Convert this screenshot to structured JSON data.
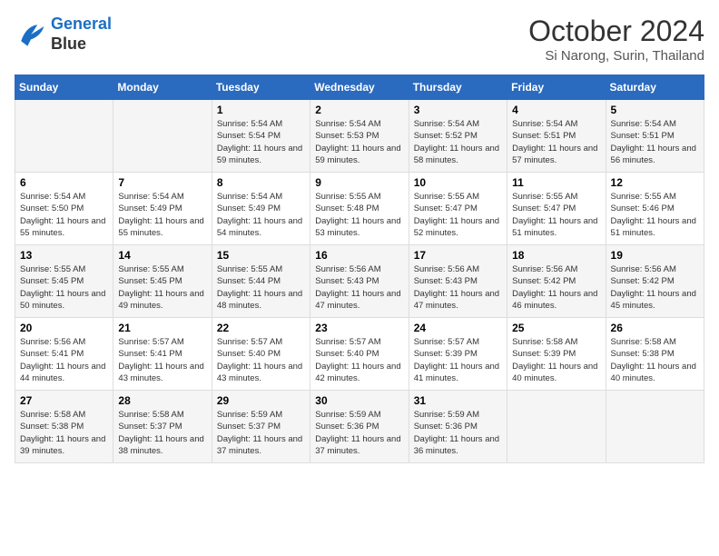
{
  "header": {
    "logo_line1": "General",
    "logo_line2": "Blue",
    "month": "October 2024",
    "location": "Si Narong, Surin, Thailand"
  },
  "weekdays": [
    "Sunday",
    "Monday",
    "Tuesday",
    "Wednesday",
    "Thursday",
    "Friday",
    "Saturday"
  ],
  "weeks": [
    [
      {
        "day": "",
        "info": ""
      },
      {
        "day": "",
        "info": ""
      },
      {
        "day": "1",
        "info": "Sunrise: 5:54 AM\nSunset: 5:54 PM\nDaylight: 11 hours and 59 minutes."
      },
      {
        "day": "2",
        "info": "Sunrise: 5:54 AM\nSunset: 5:53 PM\nDaylight: 11 hours and 59 minutes."
      },
      {
        "day": "3",
        "info": "Sunrise: 5:54 AM\nSunset: 5:52 PM\nDaylight: 11 hours and 58 minutes."
      },
      {
        "day": "4",
        "info": "Sunrise: 5:54 AM\nSunset: 5:51 PM\nDaylight: 11 hours and 57 minutes."
      },
      {
        "day": "5",
        "info": "Sunrise: 5:54 AM\nSunset: 5:51 PM\nDaylight: 11 hours and 56 minutes."
      }
    ],
    [
      {
        "day": "6",
        "info": "Sunrise: 5:54 AM\nSunset: 5:50 PM\nDaylight: 11 hours and 55 minutes."
      },
      {
        "day": "7",
        "info": "Sunrise: 5:54 AM\nSunset: 5:49 PM\nDaylight: 11 hours and 55 minutes."
      },
      {
        "day": "8",
        "info": "Sunrise: 5:54 AM\nSunset: 5:49 PM\nDaylight: 11 hours and 54 minutes."
      },
      {
        "day": "9",
        "info": "Sunrise: 5:55 AM\nSunset: 5:48 PM\nDaylight: 11 hours and 53 minutes."
      },
      {
        "day": "10",
        "info": "Sunrise: 5:55 AM\nSunset: 5:47 PM\nDaylight: 11 hours and 52 minutes."
      },
      {
        "day": "11",
        "info": "Sunrise: 5:55 AM\nSunset: 5:47 PM\nDaylight: 11 hours and 51 minutes."
      },
      {
        "day": "12",
        "info": "Sunrise: 5:55 AM\nSunset: 5:46 PM\nDaylight: 11 hours and 51 minutes."
      }
    ],
    [
      {
        "day": "13",
        "info": "Sunrise: 5:55 AM\nSunset: 5:45 PM\nDaylight: 11 hours and 50 minutes."
      },
      {
        "day": "14",
        "info": "Sunrise: 5:55 AM\nSunset: 5:45 PM\nDaylight: 11 hours and 49 minutes."
      },
      {
        "day": "15",
        "info": "Sunrise: 5:55 AM\nSunset: 5:44 PM\nDaylight: 11 hours and 48 minutes."
      },
      {
        "day": "16",
        "info": "Sunrise: 5:56 AM\nSunset: 5:43 PM\nDaylight: 11 hours and 47 minutes."
      },
      {
        "day": "17",
        "info": "Sunrise: 5:56 AM\nSunset: 5:43 PM\nDaylight: 11 hours and 47 minutes."
      },
      {
        "day": "18",
        "info": "Sunrise: 5:56 AM\nSunset: 5:42 PM\nDaylight: 11 hours and 46 minutes."
      },
      {
        "day": "19",
        "info": "Sunrise: 5:56 AM\nSunset: 5:42 PM\nDaylight: 11 hours and 45 minutes."
      }
    ],
    [
      {
        "day": "20",
        "info": "Sunrise: 5:56 AM\nSunset: 5:41 PM\nDaylight: 11 hours and 44 minutes."
      },
      {
        "day": "21",
        "info": "Sunrise: 5:57 AM\nSunset: 5:41 PM\nDaylight: 11 hours and 43 minutes."
      },
      {
        "day": "22",
        "info": "Sunrise: 5:57 AM\nSunset: 5:40 PM\nDaylight: 11 hours and 43 minutes."
      },
      {
        "day": "23",
        "info": "Sunrise: 5:57 AM\nSunset: 5:40 PM\nDaylight: 11 hours and 42 minutes."
      },
      {
        "day": "24",
        "info": "Sunrise: 5:57 AM\nSunset: 5:39 PM\nDaylight: 11 hours and 41 minutes."
      },
      {
        "day": "25",
        "info": "Sunrise: 5:58 AM\nSunset: 5:39 PM\nDaylight: 11 hours and 40 minutes."
      },
      {
        "day": "26",
        "info": "Sunrise: 5:58 AM\nSunset: 5:38 PM\nDaylight: 11 hours and 40 minutes."
      }
    ],
    [
      {
        "day": "27",
        "info": "Sunrise: 5:58 AM\nSunset: 5:38 PM\nDaylight: 11 hours and 39 minutes."
      },
      {
        "day": "28",
        "info": "Sunrise: 5:58 AM\nSunset: 5:37 PM\nDaylight: 11 hours and 38 minutes."
      },
      {
        "day": "29",
        "info": "Sunrise: 5:59 AM\nSunset: 5:37 PM\nDaylight: 11 hours and 37 minutes."
      },
      {
        "day": "30",
        "info": "Sunrise: 5:59 AM\nSunset: 5:36 PM\nDaylight: 11 hours and 37 minutes."
      },
      {
        "day": "31",
        "info": "Sunrise: 5:59 AM\nSunset: 5:36 PM\nDaylight: 11 hours and 36 minutes."
      },
      {
        "day": "",
        "info": ""
      },
      {
        "day": "",
        "info": ""
      }
    ]
  ]
}
